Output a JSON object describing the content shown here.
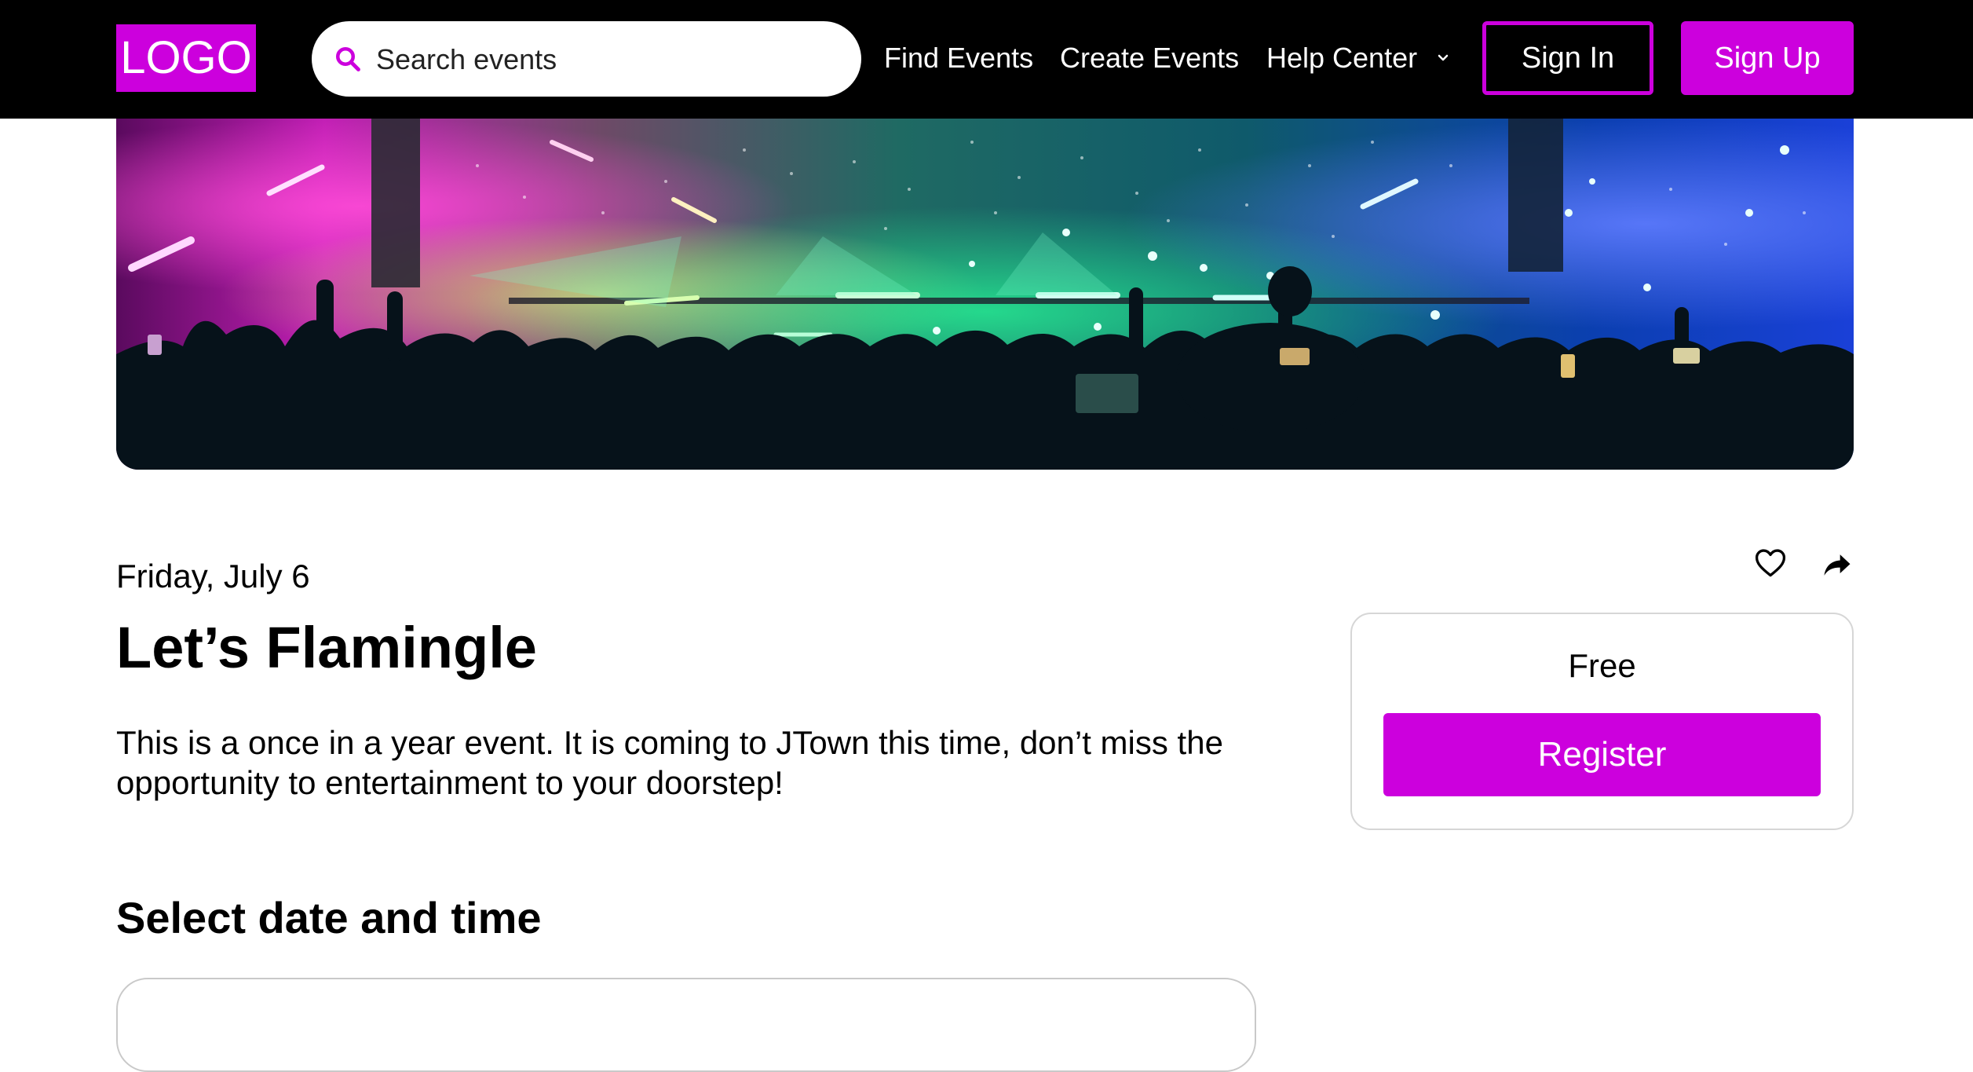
{
  "header": {
    "logo": "LOGO",
    "search_placeholder": "Search events",
    "nav": {
      "find_events": "Find Events",
      "create_events": "Create Events",
      "help_center": "Help Center"
    },
    "sign_in": "Sign In",
    "sign_up": "Sign Up"
  },
  "event": {
    "date": "Friday, July 6",
    "title": "Let’s Flamingle",
    "description": "This is a once in a year event. It is coming to JTown this time, don’t miss the opportunity to entertainment to your doorstep!"
  },
  "ticket": {
    "price": "Free",
    "register_label": "Register"
  },
  "schedule": {
    "heading": "Select date and time"
  },
  "icons": {
    "search": "search-icon",
    "chevron": "chevron-down-icon",
    "favorite": "heart-icon",
    "share": "share-icon"
  },
  "colors": {
    "brand": "#cc00dd",
    "header_bg": "#000000"
  }
}
